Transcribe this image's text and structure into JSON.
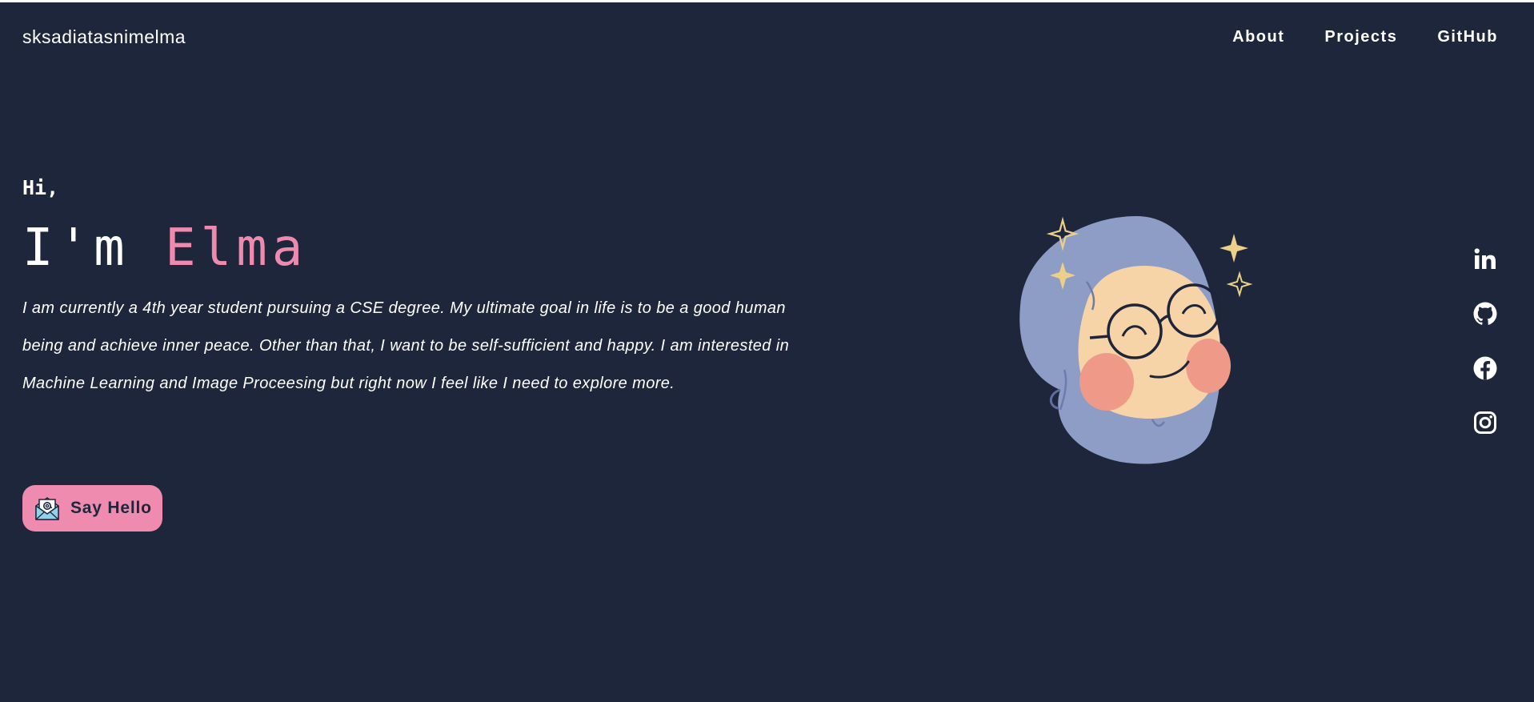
{
  "header": {
    "brand": "sksadiatasnimelma",
    "nav": [
      {
        "label": "About"
      },
      {
        "label": "Projects"
      },
      {
        "label": "GitHub"
      }
    ]
  },
  "hero": {
    "greeting": "Hi,",
    "intro_prefix": "I'm ",
    "name": "Elma",
    "bio": "I am currently a 4th year student pursuing a CSE degree. My ultimate goal in life is to be a good human being and achieve inner peace. Other than that, I want to be self-sufficient and happy. I am interested in Machine Learning and Image Proceesing but right now I feel like I need to explore more.",
    "cta_label": "Say Hello",
    "cta_icon": "envelope-at-icon"
  },
  "avatar": {
    "icon": "avatar-illustration"
  },
  "social": [
    {
      "icon": "linkedin-icon"
    },
    {
      "icon": "github-icon"
    },
    {
      "icon": "facebook-icon"
    },
    {
      "icon": "instagram-icon"
    }
  ],
  "colors": {
    "background": "#1e263c",
    "accent": "#ee8aad",
    "text": "#ffffff"
  }
}
